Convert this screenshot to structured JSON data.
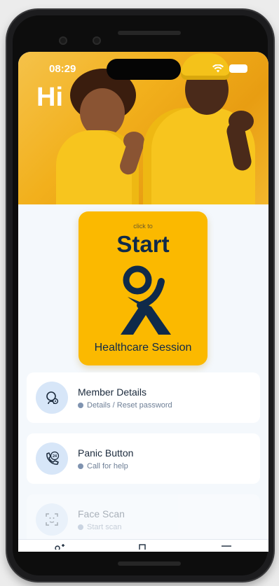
{
  "status": {
    "time": "08:29"
  },
  "hero": {
    "greeting": "Hi"
  },
  "start_card": {
    "hint": "click to",
    "title": "Start",
    "caption": "Healthcare Session"
  },
  "menu": [
    {
      "title": "Member Details",
      "subtitle": "Details / Reset password",
      "icon": "member-icon"
    },
    {
      "title": "Panic Button",
      "subtitle": "Call for help",
      "icon": "panic-24h-icon"
    },
    {
      "title": "Face Scan",
      "subtitle": "Start scan",
      "icon": "face-scan-icon"
    }
  ],
  "colors": {
    "accent": "#fbb900",
    "navy": "#0f2a4a",
    "icon_bg": "#d7e6f8"
  }
}
